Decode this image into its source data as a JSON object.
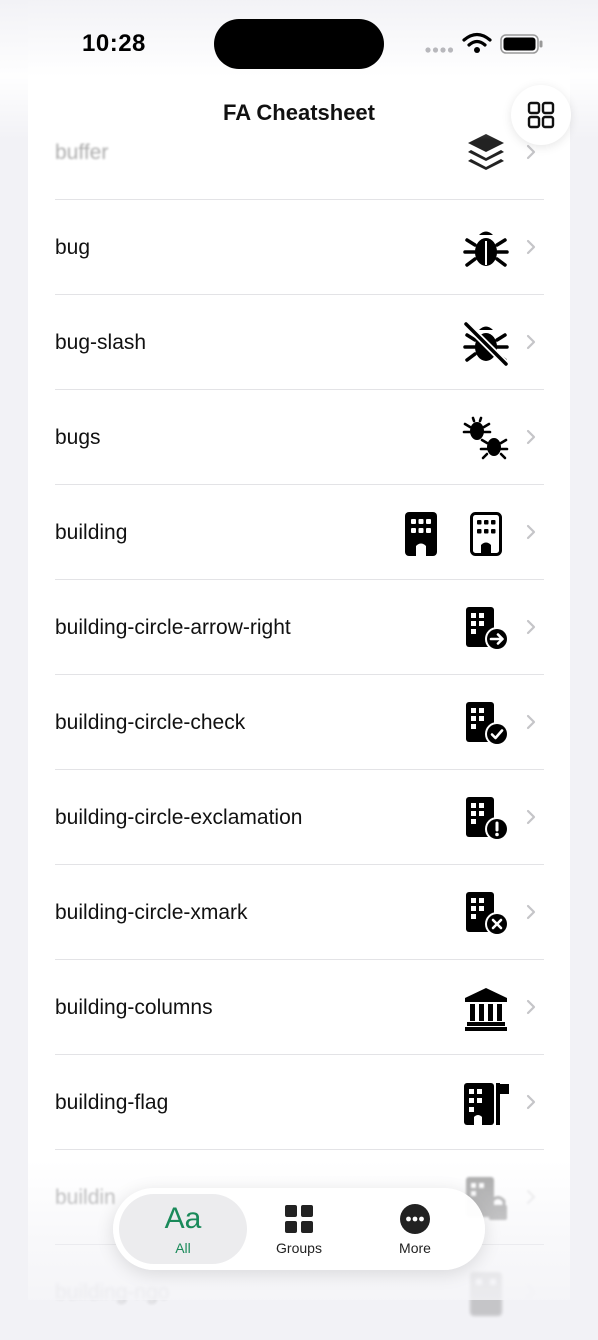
{
  "status_bar": {
    "time": "10:28"
  },
  "nav": {
    "title": "FA Cheatsheet",
    "grid_button_icon": "grid-icon"
  },
  "rows": [
    {
      "label": "buffer",
      "icon": "layer-group-icon"
    },
    {
      "label": "bug",
      "icon": "bug-icon"
    },
    {
      "label": "bug-slash",
      "icon": "bug-slash-icon"
    },
    {
      "label": "bugs",
      "icon": "bugs-icon"
    },
    {
      "label": "building",
      "icon": "building-solid-icon",
      "icon_alt": "building-regular-icon"
    },
    {
      "label": "building-circle-arrow-right",
      "icon": "building-circle-arrow-right-icon"
    },
    {
      "label": "building-circle-check",
      "icon": "building-circle-check-icon"
    },
    {
      "label": "building-circle-exclamation",
      "icon": "building-circle-exclamation-icon"
    },
    {
      "label": "building-circle-xmark",
      "icon": "building-circle-xmark-icon"
    },
    {
      "label": "building-columns",
      "icon": "building-columns-icon"
    },
    {
      "label": "building-flag",
      "icon": "building-flag-icon"
    },
    {
      "label": "buildin",
      "icon": "building-lock-icon"
    },
    {
      "label": "building-ngo",
      "icon": "building-ngo-icon"
    }
  ],
  "tabbar": {
    "tabs": [
      {
        "label": "All",
        "glyph": "Aa",
        "active": true
      },
      {
        "label": "Groups",
        "icon": "grid-icon"
      },
      {
        "label": "More",
        "icon": "ellipsis-circle-icon"
      }
    ]
  },
  "colors": {
    "accent": "#1a8a5a",
    "background": "#f2f2f6"
  }
}
